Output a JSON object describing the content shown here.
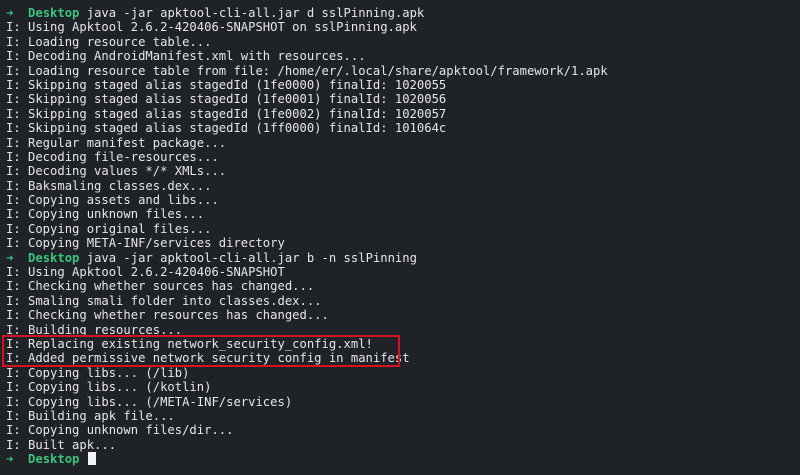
{
  "terminal": {
    "prompt_arrow": "➜",
    "prompt_dir": "Desktop",
    "lines": [
      {
        "type": "prompt",
        "cmd": "java -jar apktool-cli-all.jar d sslPinning.apk"
      },
      {
        "type": "output",
        "text": "I: Using Apktool 2.6.2-420406-SNAPSHOT on sslPinning.apk"
      },
      {
        "type": "output",
        "text": "I: Loading resource table..."
      },
      {
        "type": "output",
        "text": "I: Decoding AndroidManifest.xml with resources..."
      },
      {
        "type": "output",
        "text": "I: Loading resource table from file: /home/er/.local/share/apktool/framework/1.apk"
      },
      {
        "type": "output",
        "text": "I: Skipping staged alias stagedId (1fe0000) finalId: 1020055"
      },
      {
        "type": "output",
        "text": "I: Skipping staged alias stagedId (1fe0001) finalId: 1020056"
      },
      {
        "type": "output",
        "text": "I: Skipping staged alias stagedId (1fe0002) finalId: 1020057"
      },
      {
        "type": "output",
        "text": "I: Skipping staged alias stagedId (1ff0000) finalId: 101064c"
      },
      {
        "type": "output",
        "text": "I: Regular manifest package..."
      },
      {
        "type": "output",
        "text": "I: Decoding file-resources..."
      },
      {
        "type": "output",
        "text": "I: Decoding values */* XMLs..."
      },
      {
        "type": "output",
        "text": "I: Baksmaling classes.dex..."
      },
      {
        "type": "output",
        "text": "I: Copying assets and libs..."
      },
      {
        "type": "output",
        "text": "I: Copying unknown files..."
      },
      {
        "type": "output",
        "text": "I: Copying original files..."
      },
      {
        "type": "output",
        "text": "I: Copying META-INF/services directory"
      },
      {
        "type": "prompt",
        "cmd": "java -jar apktool-cli-all.jar b -n sslPinning"
      },
      {
        "type": "output",
        "text": "I: Using Apktool 2.6.2-420406-SNAPSHOT"
      },
      {
        "type": "output",
        "text": "I: Checking whether sources has changed..."
      },
      {
        "type": "output",
        "text": "I: Smaling smali folder into classes.dex..."
      },
      {
        "type": "output",
        "text": "I: Checking whether resources has changed..."
      },
      {
        "type": "output",
        "text": "I: Building resources..."
      },
      {
        "type": "output",
        "text": "I: Replacing existing network_security_config.xml!"
      },
      {
        "type": "output",
        "text": "I: Added permissive network security config in manifest"
      },
      {
        "type": "output",
        "text": "I: Copying libs... (/lib)"
      },
      {
        "type": "output",
        "text": "I: Copying libs... (/kotlin)"
      },
      {
        "type": "output",
        "text": "I: Copying libs... (/META-INF/services)"
      },
      {
        "type": "output",
        "text": "I: Building apk file..."
      },
      {
        "type": "output",
        "text": "I: Copying unknown files/dir..."
      },
      {
        "type": "output",
        "text": "I: Built apk..."
      },
      {
        "type": "prompt",
        "cmd": ""
      }
    ]
  },
  "colors": {
    "background": "#1f2328",
    "prompt": "#3cc47c",
    "text": "#e6e6e6",
    "highlight_border": "#d6121f"
  }
}
